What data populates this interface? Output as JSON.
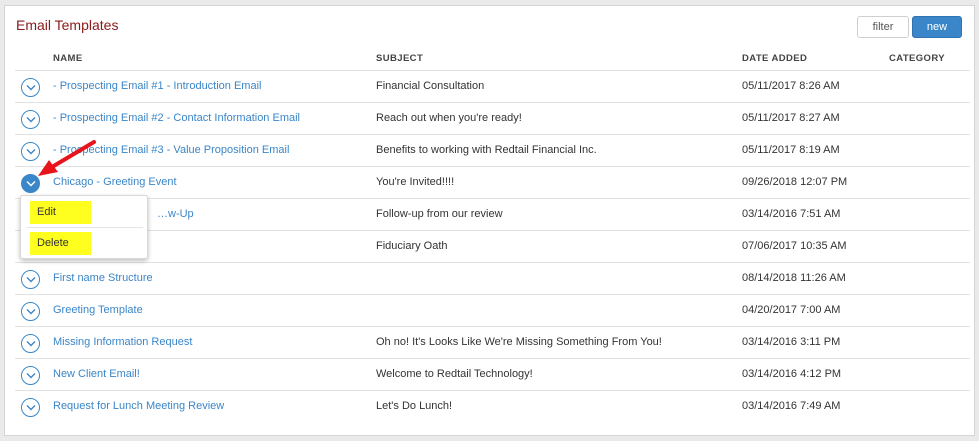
{
  "page": {
    "title": "Email Templates"
  },
  "toolbar": {
    "filter_label": "filter",
    "new_label": "new"
  },
  "columns": {
    "name": "NAME",
    "subject": "SUBJECT",
    "date": "DATE ADDED",
    "category": "CATEGORY"
  },
  "rows": [
    {
      "name": "- Prospecting Email #1 - Introduction Email",
      "subject": "Financial Consultation",
      "date": "05/11/2017 8:26 AM",
      "category": ""
    },
    {
      "name": "- Prospecting Email #2 - Contact Information Email",
      "subject": "Reach out when you're ready!",
      "date": "05/11/2017 8:27 AM",
      "category": ""
    },
    {
      "name": "- Prospecting Email #3 - Value Proposition Email",
      "subject": "Benefits to working with Redtail Financial Inc.",
      "date": "05/11/2017 8:19 AM",
      "category": ""
    },
    {
      "name": "Chicago - Greeting Event",
      "subject": "You're Invited!!!!",
      "date": "09/26/2018 12:07 PM",
      "category": ""
    },
    {
      "name": "…w-Up",
      "subject": "Follow-up from our review",
      "date": "03/14/2016 7:51 AM",
      "category": ""
    },
    {
      "name": "",
      "subject": "Fiduciary Oath",
      "date": "07/06/2017 10:35 AM",
      "category": ""
    },
    {
      "name": "First name Structure",
      "subject": "",
      "date": "08/14/2018 11:26 AM",
      "category": ""
    },
    {
      "name": "Greeting Template",
      "subject": "",
      "date": "04/20/2017 7:00 AM",
      "category": ""
    },
    {
      "name": "Missing Information Request",
      "subject": "Oh no! It's Looks Like We're Missing Something From You!",
      "date": "03/14/2016 3:11 PM",
      "category": ""
    },
    {
      "name": "New Client Email!",
      "subject": "Welcome to Redtail Technology!",
      "date": "03/14/2016 4:12 PM",
      "category": ""
    },
    {
      "name": "Request for Lunch Meeting Review",
      "subject": "Let's Do Lunch!",
      "date": "03/14/2016 7:49 AM",
      "category": ""
    }
  ],
  "row_menu": {
    "edit_label": "Edit",
    "delete_label": "Delete"
  },
  "icons": {
    "row_toggle": "chevron-down-icon",
    "annotation": "red-arrow-icon"
  },
  "colors": {
    "accent": "#3a86c8",
    "title": "#8b1a1a",
    "highlight": "#ffff1f",
    "arrow": "#e8141b"
  }
}
